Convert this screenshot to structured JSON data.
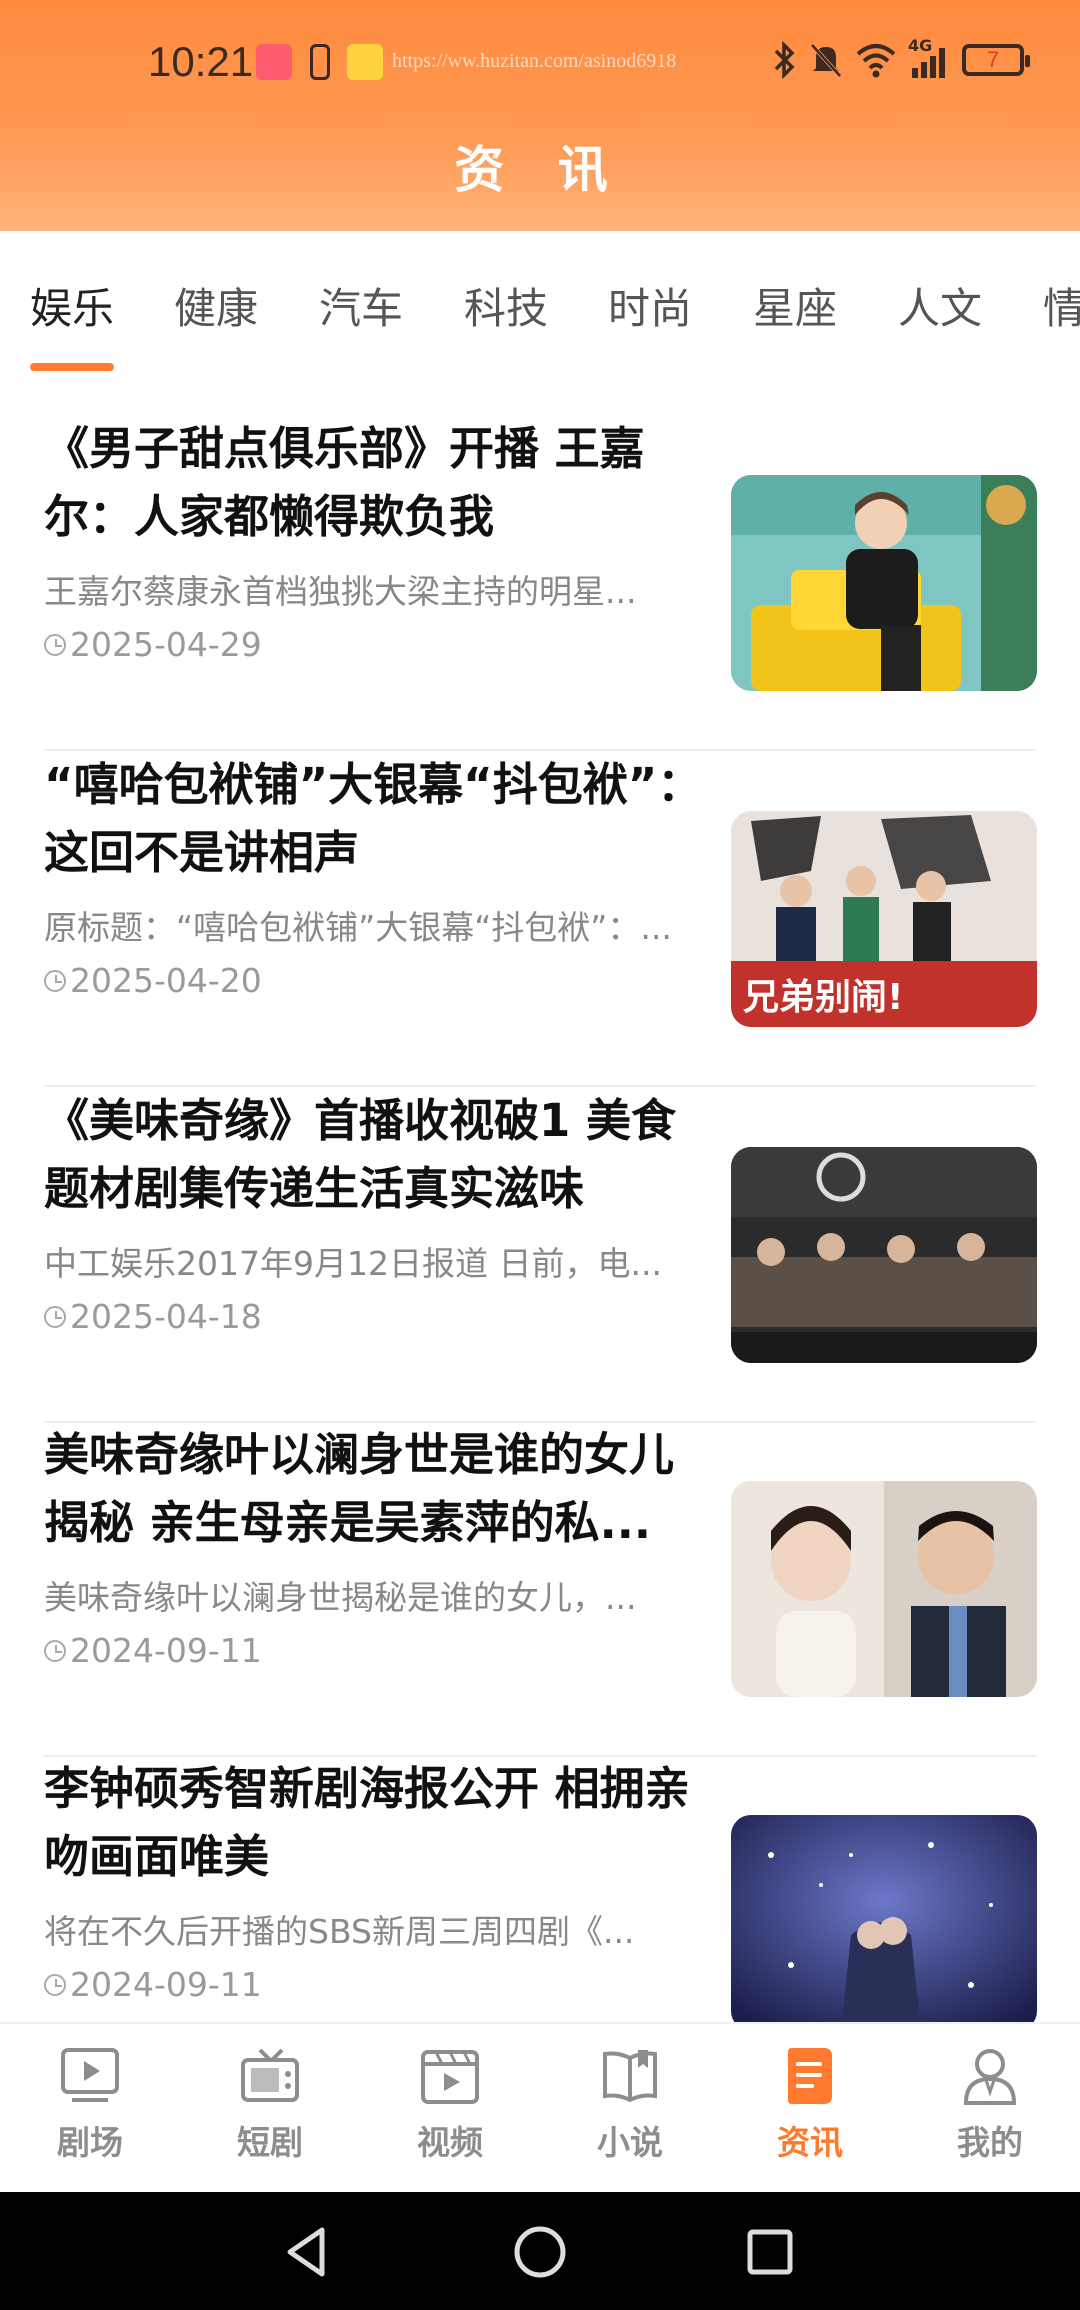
{
  "status_bar": {
    "time": "10:21",
    "url_text": "https://ww.huzitan.com/asinod6918",
    "battery": "7",
    "network": "4G"
  },
  "header": {
    "title": "资 讯"
  },
  "tabs": [
    {
      "label": "娱乐",
      "active": true
    },
    {
      "label": "健康"
    },
    {
      "label": "汽车"
    },
    {
      "label": "科技"
    },
    {
      "label": "时尚"
    },
    {
      "label": "星座"
    },
    {
      "label": "人文"
    },
    {
      "label": "情"
    }
  ],
  "articles": [
    {
      "title": "《男子甜点俱乐部》开播 王嘉尔：人家都懒得欺负我",
      "desc": "王嘉尔蔡康永首档独挑大梁主持的明星...",
      "date": "2025-04-29"
    },
    {
      "title": "“嘻哈包袱铺”大银幕“抖包袱”：这回不是讲相声",
      "desc": "原标题：“嘻哈包袱铺”大银幕“抖包袱”：...",
      "date": "2025-04-20",
      "thumb_text": "兄弟别闹!"
    },
    {
      "title": "《美味奇缘》首播收视破1 美食题材剧集传递生活真实滋味",
      "desc": "中工娱乐2017年9月12日报道 日前，电...",
      "date": "2025-04-18"
    },
    {
      "title": "美味奇缘叶以澜身世是谁的女儿揭秘 亲生母亲是吴素萍的私...",
      "desc": "美味奇缘叶以澜身世揭秘是谁的女儿，...",
      "date": "2024-09-11"
    },
    {
      "title": "李钟硕秀智新剧海报公开 相拥亲吻画面唯美",
      "desc": "将在不久后开播的SBS新周三周四剧《...",
      "date": "2024-09-11"
    }
  ],
  "bottom_nav": [
    {
      "label": "剧场",
      "icon": "play-screen-icon"
    },
    {
      "label": "短剧",
      "icon": "tv-icon"
    },
    {
      "label": "视频",
      "icon": "video-clapper-icon"
    },
    {
      "label": "小说",
      "icon": "book-icon"
    },
    {
      "label": "资讯",
      "icon": "news-doc-icon",
      "active": true
    },
    {
      "label": "我的",
      "icon": "user-icon"
    }
  ],
  "colors": {
    "accent": "#ff7a2e",
    "header_top": "#ff8a3d",
    "inactive": "#8d8d8d"
  }
}
